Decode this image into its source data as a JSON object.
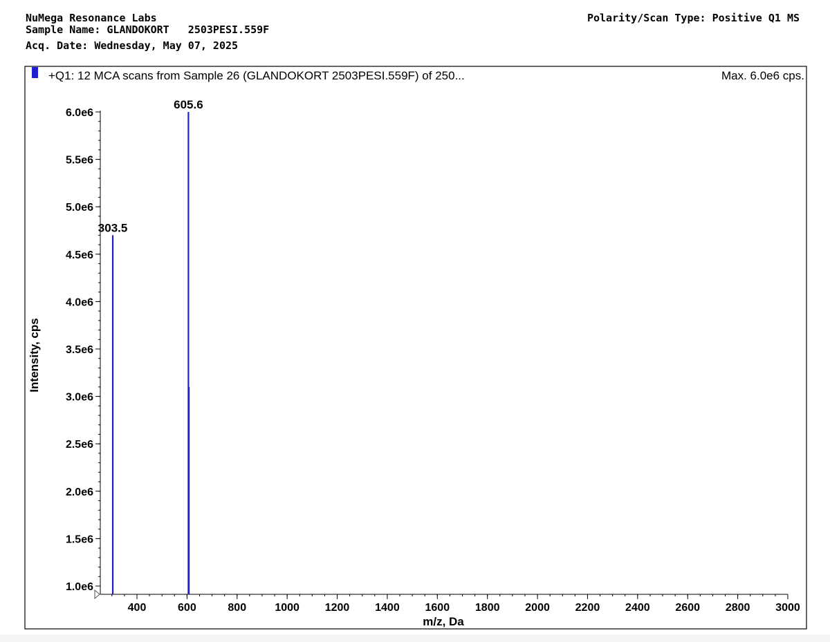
{
  "header": {
    "lab": "NuMega Resonance Labs",
    "sample_name": "Sample Name: GLANDOKORT   2503PESI.559F",
    "acq_date": "Acq. Date: Wednesday, May 07, 2025",
    "polarity": "Polarity/Scan Type: Positive Q1 MS"
  },
  "chart_data": {
    "type": "line",
    "title": "+Q1: 12 MCA scans from Sample 26 (GLANDOKORT   2503PESI.559F) of 250...",
    "max_label": "Max. 6.0e6 cps.",
    "xlabel": "m/z, Da",
    "ylabel": "Intensity, cps",
    "xlim": [
      250,
      3000
    ],
    "ylim": [
      950000,
      6050000
    ],
    "x_ticks": [
      400,
      600,
      800,
      1000,
      1200,
      1400,
      1600,
      1800,
      2000,
      2200,
      2400,
      2600,
      2800,
      3000
    ],
    "x_tick_labels": [
      "400",
      "600",
      "800",
      "1000",
      "1200",
      "1400",
      "1600",
      "1800",
      "2000",
      "2200",
      "2400",
      "2600",
      "2800",
      "3000"
    ],
    "y_ticks": [
      1000000,
      1500000,
      2000000,
      2500000,
      3000000,
      3500000,
      4000000,
      4500000,
      5000000,
      5500000,
      6000000
    ],
    "y_tick_labels": [
      "1.0e6",
      "1.5e6",
      "2.0e6",
      "2.5e6",
      "3.0e6",
      "3.5e6",
      "4.0e6",
      "4.5e6",
      "5.0e6",
      "5.5e6",
      "6.0e6"
    ],
    "series": [
      {
        "color": "#1f1fd0",
        "peaks": [
          {
            "x": 303.5,
            "y": 4700000
          },
          {
            "x": 605.6,
            "y": 6000000
          },
          {
            "x": 607.5,
            "y": 3100000
          }
        ]
      }
    ],
    "peak_labels": [
      {
        "x": 303.5,
        "y": 4700000,
        "text": "303.5"
      },
      {
        "x": 605.6,
        "y": 6000000,
        "text": "605.6"
      }
    ],
    "grid": false,
    "legend": "top-left"
  }
}
